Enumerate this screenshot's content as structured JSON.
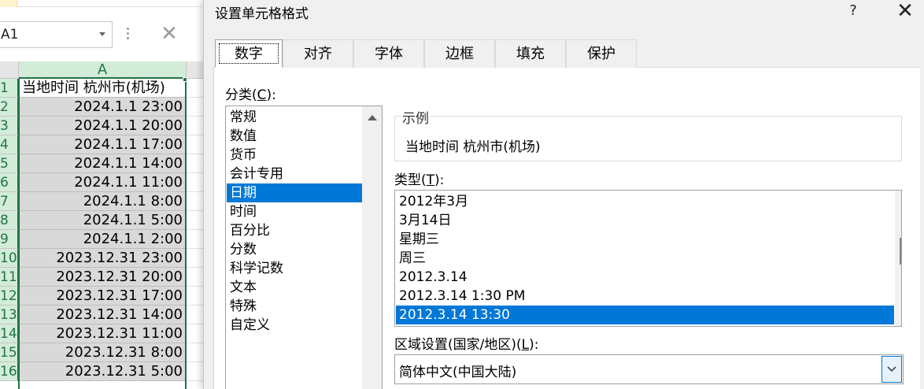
{
  "sheet": {
    "name_box": "A1",
    "column_header": "A",
    "rows": [
      {
        "n": "1",
        "v": "当地时间 杭州市(机场)"
      },
      {
        "n": "2",
        "v": "2024.1.1 23:00"
      },
      {
        "n": "3",
        "v": "2024.1.1 20:00"
      },
      {
        "n": "4",
        "v": "2024.1.1 17:00"
      },
      {
        "n": "5",
        "v": "2024.1.1 14:00"
      },
      {
        "n": "6",
        "v": "2024.1.1 11:00"
      },
      {
        "n": "7",
        "v": "2024.1.1 8:00"
      },
      {
        "n": "8",
        "v": "2024.1.1 5:00"
      },
      {
        "n": "9",
        "v": "2024.1.1 2:00"
      },
      {
        "n": "10",
        "v": "2023.12.31 23:00"
      },
      {
        "n": "11",
        "v": "2023.12.31 20:00"
      },
      {
        "n": "12",
        "v": "2023.12.31 17:00"
      },
      {
        "n": "13",
        "v": "2023.12.31 14:00"
      },
      {
        "n": "14",
        "v": "2023.12.31 11:00"
      },
      {
        "n": "15",
        "v": "2023.12.31 8:00"
      },
      {
        "n": "16",
        "v": "2023.12.31 5:00"
      }
    ]
  },
  "dialog": {
    "title": "设置单元格格式",
    "help": "?",
    "close": "✕",
    "tabs": [
      "数字",
      "对齐",
      "字体",
      "边框",
      "填充",
      "保护"
    ],
    "category_label": "分类(",
    "category_key": "C",
    "category_label_end": "):",
    "categories": [
      "常规",
      "数值",
      "货币",
      "会计专用",
      "日期",
      "时间",
      "百分比",
      "分数",
      "科学记数",
      "文本",
      "特殊",
      "自定义"
    ],
    "selected_category": "日期",
    "sample_title": "示例",
    "sample_value": "当地时间 杭州市(机场)",
    "type_label": "类型(",
    "type_key": "T",
    "type_label_end": "):",
    "types": [
      "2012年3月",
      "3月14日",
      "星期三",
      "周三",
      "2012.3.14",
      "2012.3.14 1:30 PM",
      "2012.3.14 13:30"
    ],
    "selected_type": "2012.3.14 13:30",
    "locale_label": "区域设置(国家/地区)(",
    "locale_key": "L",
    "locale_label_end": "):",
    "locale_value": "简体中文(中国大陆)"
  },
  "colors": {
    "accent": "#0078d7",
    "excel_green": "#217346"
  }
}
